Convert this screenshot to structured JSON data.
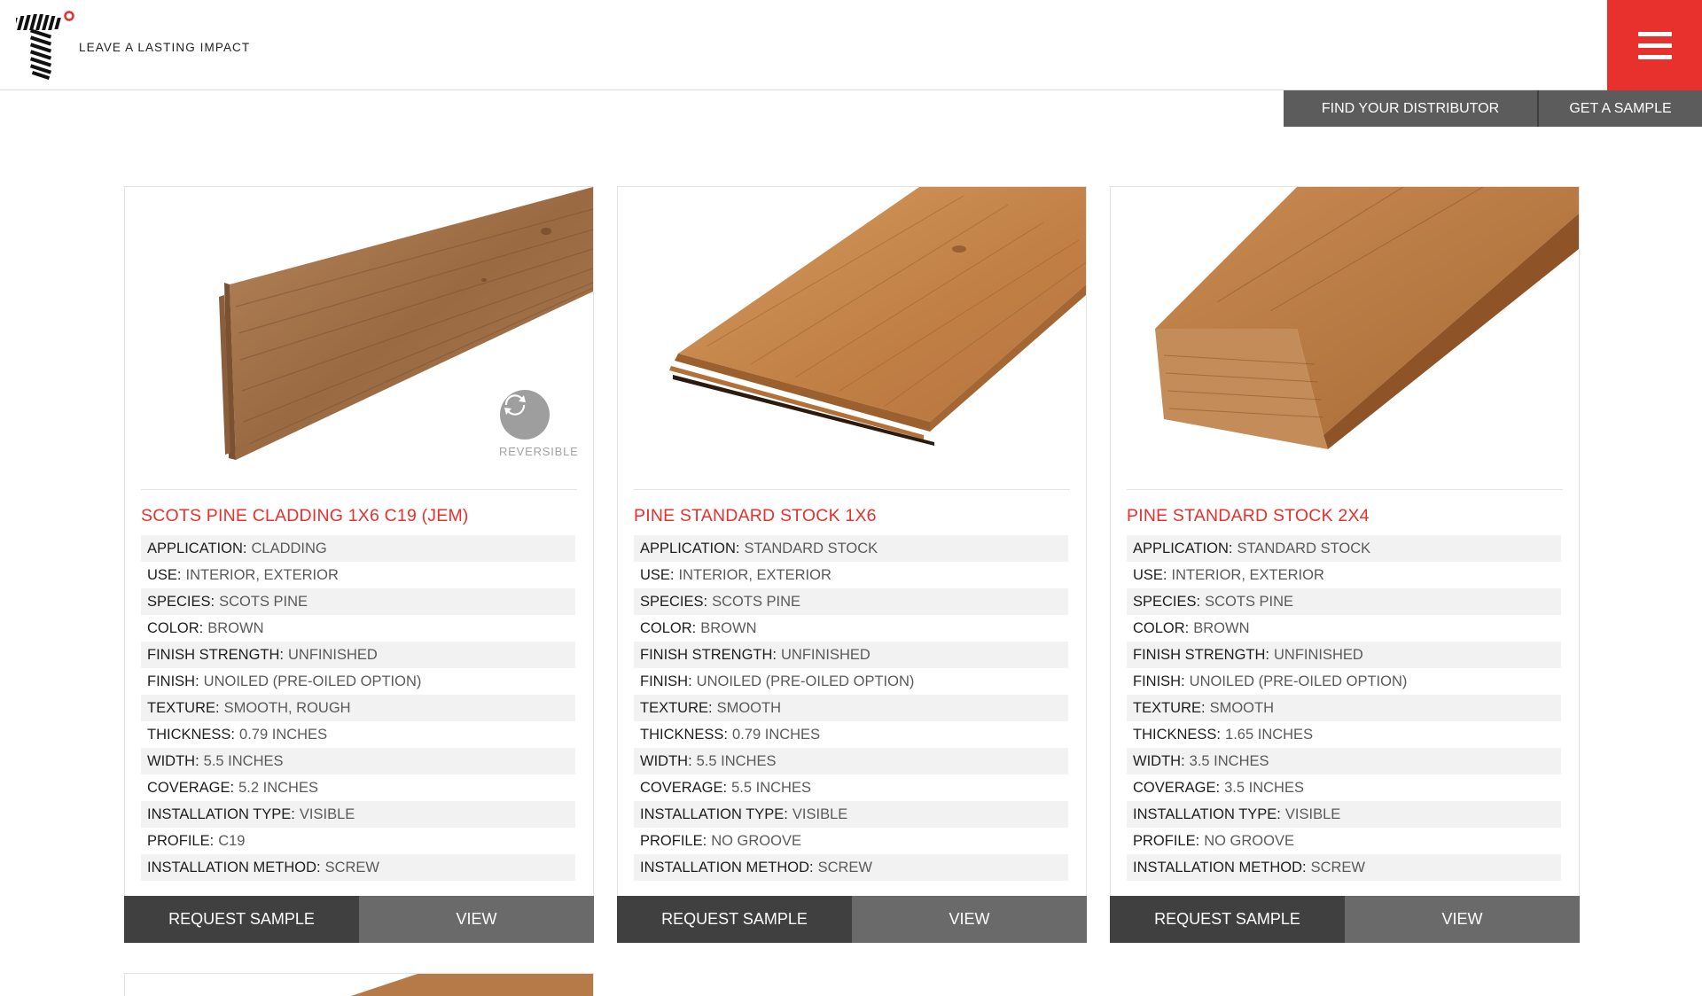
{
  "brand": {
    "tagline": "LEAVE A LASTING IMPACT",
    "accent_color": "#e8302d"
  },
  "header": {
    "menu_icon": "hamburger-icon"
  },
  "subnav": {
    "find_distributor": "FIND YOUR DISTRIBUTOR",
    "get_sample": "GET A SAMPLE"
  },
  "products": [
    {
      "title": "SCOTS PINE CLADDING 1X6 C19 (JEM)",
      "badge": "REVERSIBLE",
      "specs": [
        {
          "label": "APPLICATION:",
          "value": "CLADDING"
        },
        {
          "label": "USE:",
          "value": "INTERIOR, EXTERIOR"
        },
        {
          "label": "SPECIES:",
          "value": "SCOTS PINE"
        },
        {
          "label": "COLOR:",
          "value": "BROWN"
        },
        {
          "label": "FINISH STRENGTH:",
          "value": "UNFINISHED"
        },
        {
          "label": "FINISH:",
          "value": "UNOILED (PRE-OILED OPTION)"
        },
        {
          "label": "TEXTURE:",
          "value": "SMOOTH, ROUGH"
        },
        {
          "label": "THICKNESS:",
          "value": "0.79 INCHES"
        },
        {
          "label": "WIDTH:",
          "value": "5.5 INCHES"
        },
        {
          "label": "COVERAGE:",
          "value": "5.2 INCHES"
        },
        {
          "label": "INSTALLATION TYPE:",
          "value": "VISIBLE"
        },
        {
          "label": "PROFILE:",
          "value": "C19"
        },
        {
          "label": "INSTALLATION METHOD:",
          "value": "SCREW"
        }
      ],
      "request_label": "REQUEST SAMPLE",
      "view_label": "VIEW"
    },
    {
      "title": "PINE STANDARD STOCK 1X6",
      "specs": [
        {
          "label": "APPLICATION:",
          "value": "STANDARD STOCK"
        },
        {
          "label": "USE:",
          "value": "INTERIOR, EXTERIOR"
        },
        {
          "label": "SPECIES:",
          "value": "SCOTS PINE"
        },
        {
          "label": "COLOR:",
          "value": "BROWN"
        },
        {
          "label": "FINISH STRENGTH:",
          "value": "UNFINISHED"
        },
        {
          "label": "FINISH:",
          "value": "UNOILED (PRE-OILED OPTION)"
        },
        {
          "label": "TEXTURE:",
          "value": "SMOOTH"
        },
        {
          "label": "THICKNESS:",
          "value": "0.79 INCHES"
        },
        {
          "label": "WIDTH:",
          "value": "5.5 INCHES"
        },
        {
          "label": "COVERAGE:",
          "value": "5.5 INCHES"
        },
        {
          "label": "INSTALLATION TYPE:",
          "value": "VISIBLE"
        },
        {
          "label": "PROFILE:",
          "value": "NO GROOVE"
        },
        {
          "label": "INSTALLATION METHOD:",
          "value": "SCREW"
        }
      ],
      "request_label": "REQUEST SAMPLE",
      "view_label": "VIEW"
    },
    {
      "title": "PINE STANDARD STOCK 2X4",
      "specs": [
        {
          "label": "APPLICATION:",
          "value": "STANDARD STOCK"
        },
        {
          "label": "USE:",
          "value": "INTERIOR, EXTERIOR"
        },
        {
          "label": "SPECIES:",
          "value": "SCOTS PINE"
        },
        {
          "label": "COLOR:",
          "value": "BROWN"
        },
        {
          "label": "FINISH STRENGTH:",
          "value": "UNFINISHED"
        },
        {
          "label": "FINISH:",
          "value": "UNOILED (PRE-OILED OPTION)"
        },
        {
          "label": "TEXTURE:",
          "value": "SMOOTH"
        },
        {
          "label": "THICKNESS:",
          "value": "1.65 INCHES"
        },
        {
          "label": "WIDTH:",
          "value": "3.5 INCHES"
        },
        {
          "label": "COVERAGE:",
          "value": "3.5 INCHES"
        },
        {
          "label": "INSTALLATION TYPE:",
          "value": "VISIBLE"
        },
        {
          "label": "PROFILE:",
          "value": "NO GROOVE"
        },
        {
          "label": "INSTALLATION METHOD:",
          "value": "SCREW"
        }
      ],
      "request_label": "REQUEST SAMPLE",
      "view_label": "VIEW"
    }
  ]
}
